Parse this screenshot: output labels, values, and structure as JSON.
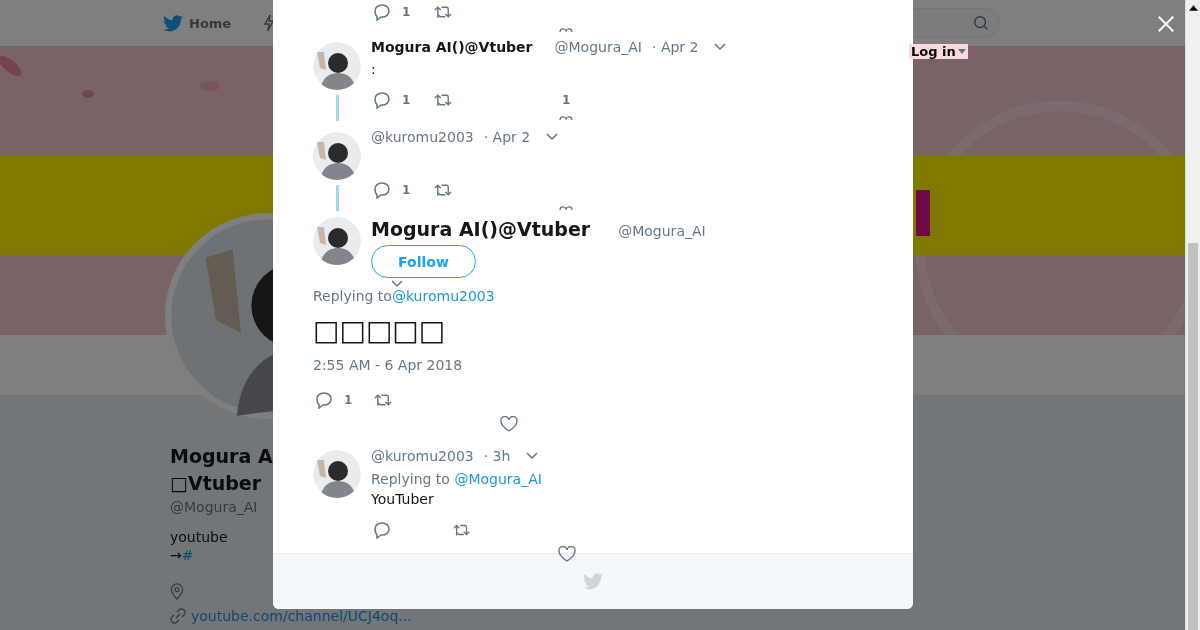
{
  "header": {
    "nav": [
      {
        "label": "Home"
      }
    ],
    "login": "Log in"
  },
  "profile": {
    "name": [
      "Mogura A",
      "□Vtuber"
    ],
    "handle": "@Mogura_AI",
    "bio": "youtube",
    "bio_arrow": "→",
    "bio_link": "#",
    "url": "youtube.com/channel/UCJ4oq..."
  },
  "thread": [
    {
      "kind": "actions",
      "reply_count": "1"
    },
    {
      "kind": "tweet",
      "name": "Mogura AI()@Vtuber",
      "handle": "@Mogura_AI",
      "time": "· Apr 2",
      "text": ":",
      "reply_count": "1",
      "like_count": "1"
    },
    {
      "kind": "tweet",
      "handle": "@kuromu2003",
      "time": "· Apr 2",
      "reply_count": "1"
    },
    {
      "kind": "focus",
      "name": "Mogura AI()@Vtuber",
      "handle": "@Mogura_AI",
      "follow": "Follow",
      "replying": "Replying to",
      "mention": "@kuromu2003",
      "text": "□□□□□",
      "date": "2:55 AM - 6 Apr 2018",
      "reply_count": "1"
    },
    {
      "kind": "reply",
      "handle": "@kuromu2003",
      "time": "· 3h",
      "replying": "Replying to",
      "mention": "@Mogura_AI",
      "text": "YouTuber"
    }
  ]
}
